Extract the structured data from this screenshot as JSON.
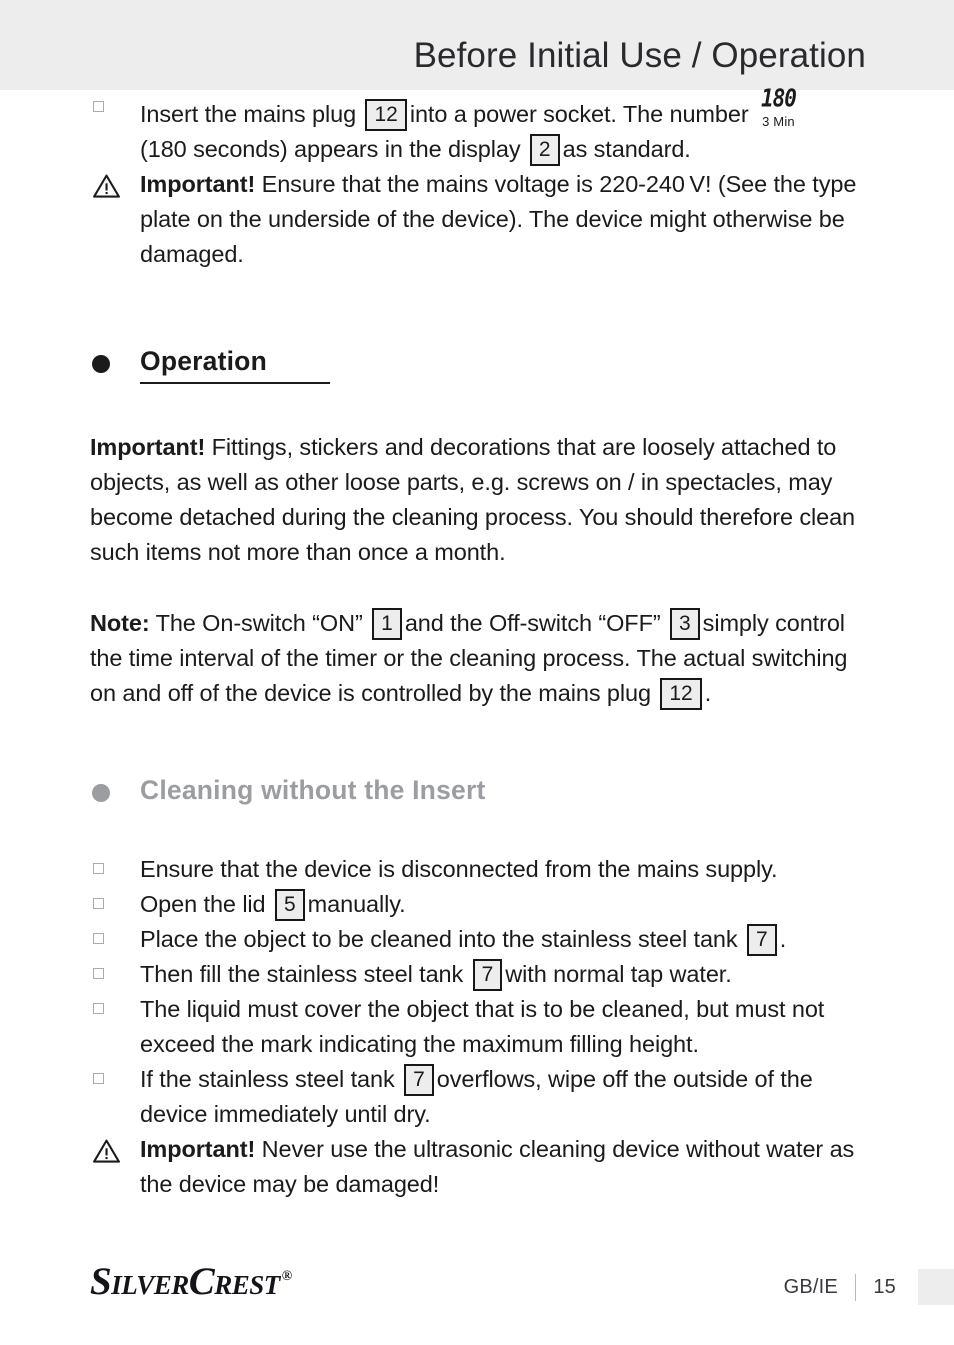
{
  "header": {
    "title": "Before Initial Use / Operation"
  },
  "intro": {
    "item1": {
      "part_a": "Insert the mains plug",
      "ref_12": "12",
      "part_b": "into a power socket. The number",
      "lcd_value": "180",
      "lcd_label": "3 Min",
      "part_c": "(180 seconds) appears in the display",
      "ref_2": "2",
      "part_d": "as standard."
    },
    "warning1": {
      "label": "Important!",
      "text": "Ensure that the mains voltage is 220-240 V! (See the type plate on the underside of the device). The device might otherwise be damaged."
    }
  },
  "operation": {
    "heading": "Operation",
    "important": {
      "label": "Important!",
      "text": "Fittings, stickers and decorations that are loosely attached to objects, as well as other loose parts, e.g. screws on / in spectacles, may become detached during the cleaning process. You should therefore clean such items not more than once a month."
    },
    "note": {
      "label": "Note:",
      "part_a": "The On-switch “ON”",
      "ref_1": "1",
      "part_b": "and the Off-switch “OFF”",
      "ref_3": "3",
      "part_c": "simply control the time interval of the timer or the cleaning process. The actual switching on and off of the device is controlled by the mains plug",
      "ref_12": "12",
      "part_d": "."
    }
  },
  "cleaning": {
    "heading": "Cleaning without the Insert",
    "items": [
      {
        "text_a": "Ensure that the device is disconnected from the mains supply.",
        "ref": null,
        "text_b": null
      },
      {
        "text_a": "Open the lid",
        "ref": "5",
        "text_b": "manually."
      },
      {
        "text_a": "Place the object to be cleaned into the stainless steel tank",
        "ref": "7",
        "text_b": "."
      },
      {
        "text_a": "Then fill the stainless steel tank",
        "ref": "7",
        "text_b": "with normal tap water."
      },
      {
        "text_a": "The liquid must cover the object that is to be cleaned, but must not exceed the mark indicating the maximum filling height.",
        "ref": null,
        "text_b": null
      },
      {
        "text_a": "If the stainless steel tank",
        "ref": "7",
        "text_b": "overflows, wipe off the outside of the device immediately until dry."
      }
    ],
    "warning": {
      "label": "Important!",
      "text": "Never use the ultrasonic cleaning device without water as the device may be damaged!"
    }
  },
  "footer": {
    "brand_silver": "Silver",
    "brand_crest": "Crest",
    "registered": "®",
    "locale": "GB/IE",
    "page_number": "15"
  },
  "colors": {
    "header_band": "#ecedec",
    "text": "#1b1b1b",
    "gray_heading": "#9b9da1",
    "ref_box_fill": "#ededed",
    "ref_box_border": "#17171a",
    "marker_border": "#a9acae"
  }
}
